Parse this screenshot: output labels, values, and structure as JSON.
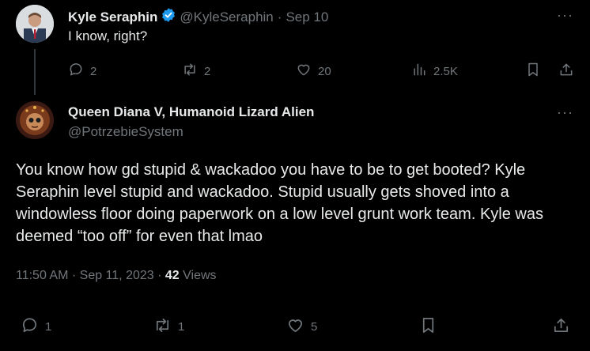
{
  "reply": {
    "author_name": "Kyle Seraphin",
    "handle": "@KyleSeraphin",
    "separator": "·",
    "date": "Sep 10",
    "text": "I know, right?",
    "stats": {
      "replies": "2",
      "reposts": "2",
      "likes": "20",
      "views": "2.5K"
    }
  },
  "main": {
    "author_name": "Queen Diana V, Humanoid Lizard Alien",
    "handle": "@PotrzebieSystem",
    "text": "You know how gd stupid & wackadoo you have to be to get booted? Kyle Seraphin level stupid and wackadoo. Stupid usually gets shoved into a windowless floor doing paperwork on a low level grunt work team. Kyle was deemed “too off” for even that lmao",
    "time": "11:50 AM",
    "dot": "·",
    "date": "Sep 11, 2023",
    "dot2": "·",
    "views_count": "42",
    "views_label": "Views",
    "stats": {
      "replies": "1",
      "reposts": "1",
      "likes": "5"
    }
  },
  "more_label": "···",
  "colors": {
    "background": "#000000",
    "text": "#e7e9ea",
    "secondary": "#71767b",
    "verified": "#1d9bf0"
  },
  "icons": [
    "reply-icon",
    "repost-icon",
    "like-icon",
    "views-icon",
    "bookmark-icon",
    "share-icon",
    "verified-badge-icon"
  ]
}
